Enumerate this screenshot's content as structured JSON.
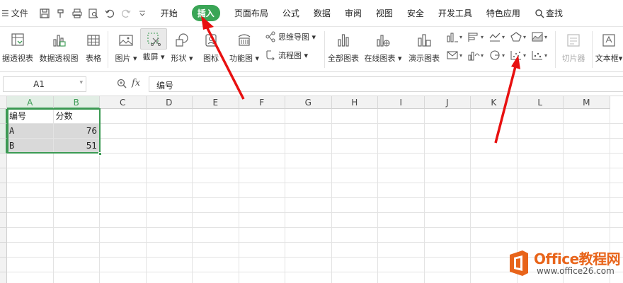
{
  "menubar": {
    "file_label": "文件",
    "tabs": [
      {
        "label": "开始"
      },
      {
        "label": "插入",
        "active": true
      },
      {
        "label": "页面布局"
      },
      {
        "label": "公式"
      },
      {
        "label": "数据"
      },
      {
        "label": "审阅"
      },
      {
        "label": "视图"
      },
      {
        "label": "安全"
      },
      {
        "label": "开发工具"
      },
      {
        "label": "特色应用"
      }
    ],
    "search_label": "查找"
  },
  "ribbon": {
    "pivot_table": "据透视表",
    "pivot_chart": "数据透视图",
    "table": "表格",
    "picture": "图片",
    "screenshot": "截屏",
    "shapes": "形状",
    "icons": "图标",
    "function_chart": "功能图",
    "mind_map": "思维导图",
    "flowchart": "流程图",
    "all_charts": "全部图表",
    "online_charts": "在线图表",
    "demo_charts": "演示图表",
    "slicer": "切片器",
    "textbox": "文本框"
  },
  "formula_bar": {
    "cell_ref": "A1",
    "fx_label": "fx",
    "content": "编号"
  },
  "sheet": {
    "columns": [
      "A",
      "B",
      "C",
      "D",
      "E",
      "F",
      "G",
      "H",
      "I",
      "J",
      "K",
      "L",
      "M"
    ],
    "header_row": [
      "编号",
      "分数"
    ],
    "rows": [
      {
        "name": "A",
        "score": "76"
      },
      {
        "name": "B",
        "score": "51"
      }
    ]
  },
  "watermark": {
    "brand": "Office教程网",
    "url": "www.office26.com"
  },
  "colors": {
    "accent_green": "#3aa556",
    "arrow_red": "#e81010",
    "brand_orange": "#e8641a"
  }
}
